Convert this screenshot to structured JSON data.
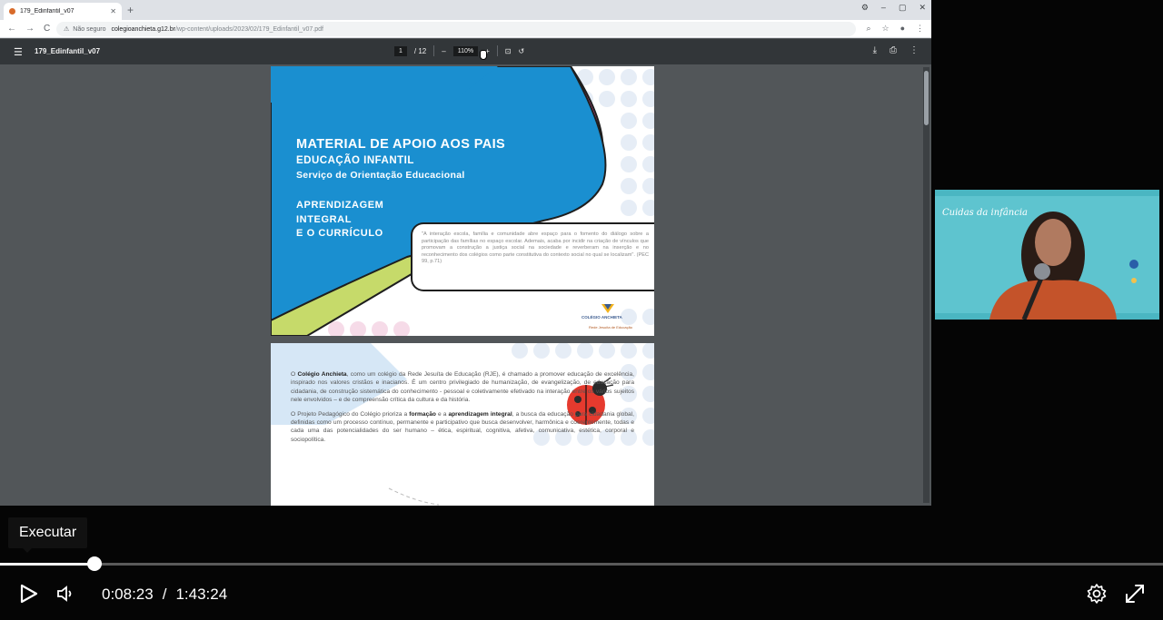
{
  "browser": {
    "tab_title": "179_Edinfantil_v07",
    "tab_close": "✕",
    "new_tab": "+",
    "window_controls": [
      "⚙",
      "–",
      "▢",
      "✕"
    ],
    "nav": [
      "←",
      "→",
      "C"
    ],
    "security_label": "Não seguro",
    "url_host": "colegioanchieta.g12.br",
    "url_path": "/wp-content/uploads/2023/02/179_Edinfantil_v07.pdf"
  },
  "pdf_toolbar": {
    "file_name": "179_Edinfantil_v07",
    "page_current": "1",
    "page_total": "/ 12",
    "zoom_minus": "–",
    "zoom": "110%",
    "zoom_plus": "+"
  },
  "page1": {
    "title": "MATERIAL DE APOIO AOS PAIS",
    "subtitle": "EDUCAÇÃO INFANTIL",
    "service": "Serviço de Orientação Educacional",
    "topic_line1": "APRENDIZAGEM",
    "topic_line2": "INTEGRAL",
    "topic_line3": "E O CURRÍCULO",
    "quote": "\"A interação escola, família e comunidade abre espaço para o fomento do diálogo sobre a participação das famílias no espaço escolar. Ademais, acaba por incidir na criação de vínculos que promovam a construção a justiça social na sociedade e reverberam na inserção e no reconhecimento dos colégios como parte constitutiva do contexto social no qual se localizam\". (PEC 99, p.71)",
    "logo_text": "COLÉGIO ANCHIETA",
    "logo_sub": "Rede Jesuíta de Educação"
  },
  "page2": {
    "para1_lead": "O ",
    "para1_bold": "Colégio Anchieta",
    "para1_rest": ", como um colégio da Rede Jesuíta de Educação (RJE), é chamado a promover educação de excelência, inspirado nos valores cristãos e inacianos. É um centro privilegiado de humanização, de evangelização, de educação para cidadania, de construção sistemática do conhecimento - pessoal e coletivamente efetivado na interação entre os vários sujeitos nele envolvidos – e de compreensão crítica da cultura e da história.",
    "para2_a": "O Projeto Pedagógico do Colégio prioriza a ",
    "para2_b": "formação",
    "para2_c": " e a ",
    "para2_d": "aprendizagem integral",
    "para2_e": ", a busca da educação para cidadania global, definidas como um processo contínuo, permanente e participativo que busca desenvolver, harmônica e coerentemente, todas e cada uma das potencialidades do ser humano – ética, espiritual, cognitiva, afetiva, comunicativa, estética, corporal e sociopolítica."
  },
  "webcam": {
    "banner": "Cuidas da infância"
  },
  "player": {
    "tooltip": "Executar",
    "progress_fraction": 0.081,
    "current_time": "0:08:23",
    "separator": "/",
    "duration": "1:43:24"
  }
}
